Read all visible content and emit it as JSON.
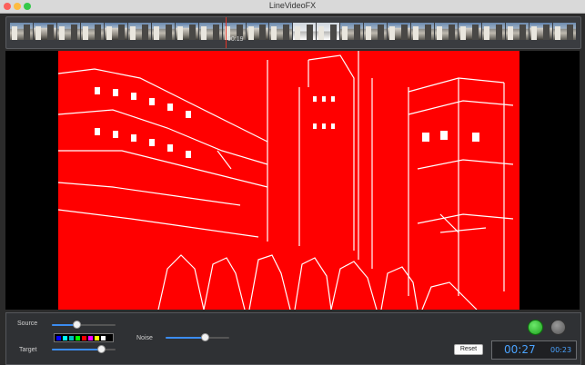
{
  "window": {
    "title": "LineVideoFX"
  },
  "timeline": {
    "timecode": "00:19",
    "playhead_color": "#e2362a",
    "frame_count": 24
  },
  "controls": {
    "source_label": "Source",
    "target_label": "Target",
    "noise_label": "Noise",
    "reset_label": "Reset",
    "source_value": 0.38,
    "target_value": 0.82,
    "noise_value": 0.64,
    "swatch_colors": [
      "#0000ff",
      "#00ffff",
      "#00c0c0",
      "#00ff00",
      "#ff0000",
      "#ff00ff",
      "#ffff00",
      "#ffffff"
    ],
    "record_color": "#34c84a",
    "current_time": "00:27",
    "duration": "00:23"
  },
  "video": {
    "effect_color": "#ff0000",
    "line_color": "#ffffff"
  }
}
